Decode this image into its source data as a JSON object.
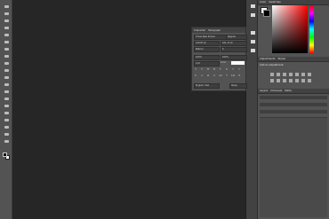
{
  "tools": [
    "move",
    "marquee",
    "lasso",
    "quick-select",
    "crop",
    "eyedropper",
    "healing",
    "brush",
    "clone",
    "history",
    "eraser",
    "gradient",
    "blur",
    "dodge",
    "pen",
    "type",
    "path-select",
    "shape",
    "hand",
    "zoom"
  ],
  "right_panel": {
    "color_tabs": [
      "Color",
      "Swatches"
    ],
    "adjust_tabs": [
      "Adjustments",
      "Styles"
    ],
    "adjust_hint": "Add an adjustment",
    "layers_tabs": [
      "Layers",
      "Channels",
      "Paths"
    ]
  },
  "character_panel": {
    "tabs": [
      "Character",
      "Paragraph"
    ],
    "font_family": "Times New Roman",
    "font_style": "Regular",
    "font_size": "120.87 pt",
    "leading": "161.17 pt",
    "kerning": "Metrics",
    "tracking": "0",
    "vscale": "100%",
    "hscale": "100%",
    "baseline": "0 pt",
    "color_label": "Color:",
    "language": "English: USA",
    "antialias": "Sharp",
    "style_buttons": [
      "T",
      "T",
      "TT",
      "Tt",
      "T¹",
      "T₁",
      "T",
      "T"
    ],
    "feature_buttons": [
      "fi",
      "ơ",
      "st",
      "A",
      "ad",
      "T",
      "1st",
      "½"
    ]
  }
}
